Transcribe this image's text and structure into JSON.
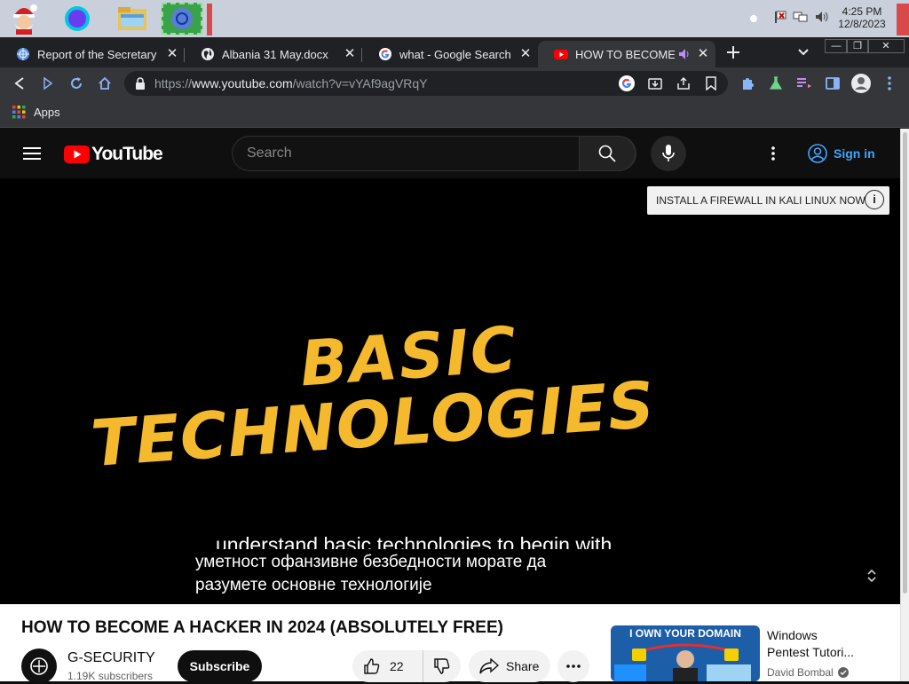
{
  "taskbar": {
    "clock_time": "4:25 PM",
    "clock_date": "12/8/2023"
  },
  "browser": {
    "tabs": [
      {
        "title": "Report of the Secretary G",
        "icon": "un-globe-icon"
      },
      {
        "title": "Albania 31 May.docx",
        "icon": "globe-icon"
      },
      {
        "title": "what - Google Search",
        "icon": "google-icon"
      },
      {
        "title": "HOW TO BECOME A",
        "icon": "youtube-icon",
        "active": true,
        "audio": "speaker-icon"
      }
    ],
    "url_prefix": "https://",
    "url_host": "www.youtube.com",
    "url_path": "/watch?v=vYAf9agVRqY",
    "bookmarks": {
      "apps_label": "Apps"
    }
  },
  "youtube": {
    "logo_text": "YouTube",
    "search_placeholder": "Search",
    "signin_label": "Sign in",
    "player": {
      "ad_text": "INSTALL A FIREWALL IN KALI LINUX NOW",
      "ad_info": "i",
      "headline_line1": "BASIC",
      "headline_line2": "TECHNOLOGIES",
      "caption_en": "understand basic technologies to begin with",
      "caption_mk_line1": "уметност офанзивне безбедности морате да",
      "caption_mk_line2": "разумете основне технологије"
    },
    "video": {
      "title": "HOW TO BECOME A HACKER IN 2024 (ABSOLUTELY FREE)",
      "channel": "G-SECURITY",
      "subscribers": "1.19K subscribers",
      "subscribe_label": "Subscribe",
      "likes": "22",
      "share_label": "Share"
    },
    "recommended": {
      "thumb_text": "I OWN YOUR DOMAIN",
      "title_line1": "Windows",
      "title_line2": "Pentest Tutori...",
      "channel": "David Bombal"
    }
  },
  "colors": {
    "youtube_red": "#ff0000",
    "headline_yellow": "#f5b92e",
    "link_blue": "#3ea6ff"
  }
}
